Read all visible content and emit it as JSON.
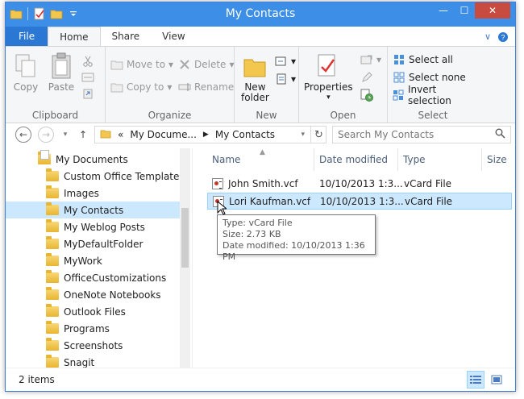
{
  "window": {
    "title": "My Contacts",
    "controls": {
      "minimize": "—",
      "maximize": "☐",
      "close": "✕"
    }
  },
  "ribbon": {
    "tabs": [
      {
        "label": "File"
      },
      {
        "label": "Home"
      },
      {
        "label": "Share"
      },
      {
        "label": "View"
      }
    ],
    "clipboard": {
      "copy": "Copy",
      "paste": "Paste",
      "label": "Clipboard"
    },
    "organize": {
      "move_to": "Move to",
      "copy_to": "Copy to",
      "delete": "Delete",
      "rename": "Rename",
      "label": "Organize"
    },
    "new": {
      "new_folder_line1": "New",
      "new_folder_line2": "folder",
      "label": "New"
    },
    "open": {
      "properties": "Properties",
      "label": "Open"
    },
    "select": {
      "select_all": "Select all",
      "select_none": "Select none",
      "invert_selection": "Invert selection",
      "label": "Select"
    }
  },
  "addressbar": {
    "overflow": "«",
    "segments": [
      "My Docume...",
      "My Contacts"
    ],
    "search_placeholder": "Search My Contacts"
  },
  "navpane": {
    "items": [
      {
        "label": "My Documents"
      },
      {
        "label": "Custom Office Templates"
      },
      {
        "label": "Images"
      },
      {
        "label": "My Contacts"
      },
      {
        "label": "My Weblog Posts"
      },
      {
        "label": "MyDefaultFolder"
      },
      {
        "label": "MyWork"
      },
      {
        "label": "OfficeCustomizations"
      },
      {
        "label": "OneNote Notebooks"
      },
      {
        "label": "Outlook Files"
      },
      {
        "label": "Programs"
      },
      {
        "label": "Screenshots"
      },
      {
        "label": "Snagit"
      }
    ]
  },
  "filelist": {
    "columns": [
      "Name",
      "Date modified",
      "Type",
      "Size"
    ],
    "rows": [
      {
        "name": "John Smith.vcf",
        "date": "10/10/2013 1:3...",
        "type": "vCard File"
      },
      {
        "name": "Lori Kaufman.vcf",
        "date": "10/10/2013 1:3...",
        "type": "vCard File"
      }
    ]
  },
  "tooltip": {
    "type": "Type: vCard File",
    "size": "Size: 2.73 KB",
    "date": "Date modified: 10/10/2013 1:36 PM"
  },
  "status": {
    "items": "2 items"
  },
  "colors": {
    "titlebar": "#3c8ee6",
    "file_tab": "#2a78d4",
    "selection": "#cce8ff",
    "close": "#c74b3e"
  }
}
